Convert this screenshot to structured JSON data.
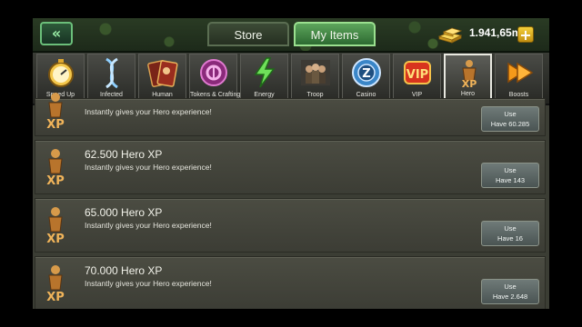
{
  "header": {
    "back_icon": "double-chevron-left-icon",
    "tabs": [
      {
        "label": "Store",
        "selected": false
      },
      {
        "label": "My Items",
        "selected": true
      }
    ],
    "gold_amount": "1.941,65m",
    "plus_label": "+"
  },
  "categories": [
    {
      "label": "Speed Up",
      "icon": "stopwatch-icon"
    },
    {
      "label": "Infected",
      "icon": "dna-icon"
    },
    {
      "label": "Human",
      "icon": "cards-icon"
    },
    {
      "label": "Tokens & Crafting",
      "icon": "token-icon"
    },
    {
      "label": "Energy",
      "icon": "lightning-icon"
    },
    {
      "label": "Troop",
      "icon": "troop-icon"
    },
    {
      "label": "Casino",
      "icon": "casino-chip-icon"
    },
    {
      "label": "VIP",
      "icon": "vip-icon"
    },
    {
      "label": "Hero",
      "icon": "hero-xp-icon",
      "selected": true
    },
    {
      "label": "Boosts",
      "icon": "arrow-right-icon"
    }
  ],
  "items": [
    {
      "title": "",
      "description": "Instantly gives your Hero experience!",
      "use_label": "Use",
      "have_label": "Have 60.285"
    },
    {
      "title": "62.500 Hero XP",
      "description": "Instantly gives your Hero experience!",
      "use_label": "Use",
      "have_label": "Have 143"
    },
    {
      "title": "65.000 Hero XP",
      "description": "Instantly gives your Hero experience!",
      "use_label": "Use",
      "have_label": "Have 16"
    },
    {
      "title": "70.000 Hero XP",
      "description": "Instantly gives your Hero experience!",
      "use_label": "Use",
      "have_label": "Have 2.648"
    }
  ],
  "colors": {
    "tab_selected": "#4f9a50",
    "gold": "#e8b92a",
    "button": "#5d6866"
  }
}
